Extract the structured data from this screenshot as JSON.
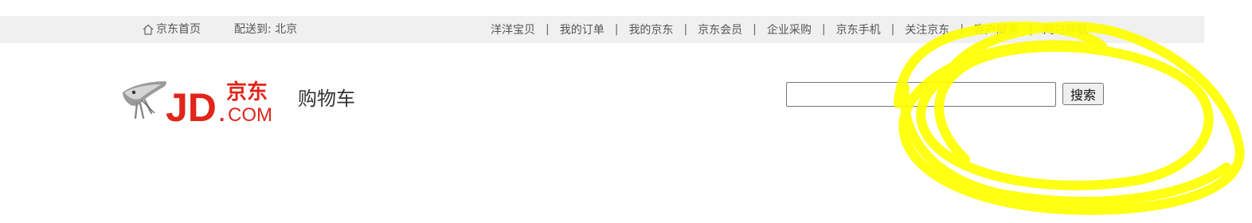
{
  "topbar": {
    "home_label": "京东首页",
    "location_label": "配送到: 北京",
    "nav_items": [
      "洋洋宝贝",
      "我的订单",
      "我的京东",
      "京东会员",
      "企业采购",
      "京东手机",
      "关注京东",
      "客户服务",
      "网站导航"
    ],
    "separator": "|"
  },
  "header": {
    "logo_main": "JD",
    "logo_dot": ".",
    "logo_cn": "京东",
    "logo_com": "COM",
    "page_title": "购物车"
  },
  "search": {
    "value": "",
    "button_label": "搜索"
  },
  "colors": {
    "brand_red": "#e1251b",
    "topbar_bg": "#f0f0f0",
    "annotation_yellow": "#ffff00"
  }
}
